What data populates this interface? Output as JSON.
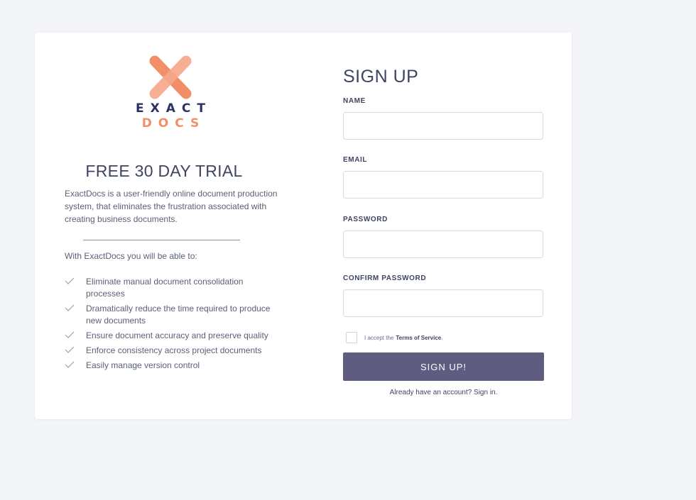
{
  "brand": {
    "word_top": "EXACT",
    "word_bottom": "DOCS",
    "logo_icon": "x-mark-logo",
    "colors": {
      "navy": "#2d3160",
      "coral": "#f28e68",
      "coral_light": "#f7a98b"
    }
  },
  "promo": {
    "title": "FREE 30 DAY TRIAL",
    "intro": "ExactDocs is a user-friendly online document production system, that eliminates the frustration associated with creating business documents.",
    "lead": "With ExactDocs you will be able to:",
    "check_icon": "checkmark-icon",
    "features": [
      "Eliminate manual document consolidation processes",
      "Dramatically reduce the time required to produce new documents",
      "Ensure document accuracy and preserve quality",
      "Enforce consistency across project documents",
      "Easily manage version control"
    ]
  },
  "form": {
    "title": "SIGN UP",
    "fields": [
      {
        "label": "NAME",
        "value": "",
        "placeholder": ""
      },
      {
        "label": "EMAIL",
        "value": "",
        "placeholder": ""
      },
      {
        "label": "PASSWORD",
        "value": "",
        "placeholder": ""
      },
      {
        "label": "CONFIRM PASSWORD",
        "value": "",
        "placeholder": ""
      }
    ],
    "terms": {
      "checked": false,
      "prefix": "I accept the",
      "link": "Terms of Service",
      "suffix": "."
    },
    "submit_label": "SIGN UP!",
    "signin_text": "Already have an account? Sign in.",
    "button_color": "#5e5c80"
  }
}
